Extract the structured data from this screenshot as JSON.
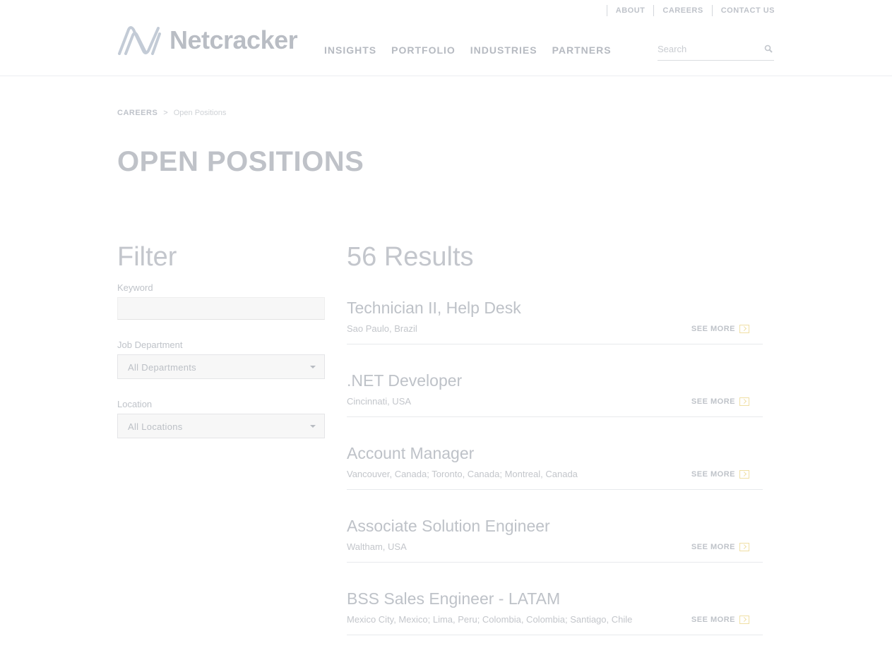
{
  "utility_nav": [
    "ABOUT",
    "CAREERS",
    "CONTACT US"
  ],
  "brand": {
    "name": "Netcracker"
  },
  "main_nav": [
    "INSIGHTS",
    "PORTFOLIO",
    "INDUSTRIES",
    "PARTNERS"
  ],
  "search": {
    "placeholder": "Search",
    "value": ""
  },
  "breadcrumb": {
    "root": "CAREERS",
    "separator": ">",
    "current": "Open Positions"
  },
  "page_title": "OPEN POSITIONS",
  "filter": {
    "heading": "Filter",
    "keyword_label": "Keyword",
    "keyword_value": "",
    "department_label": "Job Department",
    "department_value": "All Departments",
    "location_label": "Location",
    "location_value": "All Locations"
  },
  "results": {
    "count_label": "56 Results",
    "see_more_label": "SEE MORE",
    "jobs": [
      {
        "title": "Technician II, Help Desk",
        "location": "Sao Paulo, Brazil"
      },
      {
        "title": ".NET Developer",
        "location": "Cincinnati, USA"
      },
      {
        "title": "Account Manager",
        "location": "Vancouver, Canada; Toronto, Canada; Montreal, Canada"
      },
      {
        "title": "Associate Solution Engineer",
        "location": "Waltham, USA"
      },
      {
        "title": "BSS Sales Engineer - LATAM",
        "location": "Mexico City, Mexico; Lima, Peru; Colombia, Colombia; Santiago, Chile"
      }
    ]
  },
  "colors": {
    "see_more_icon": "#f0dfa4",
    "text_muted": "#c6c9cf"
  }
}
